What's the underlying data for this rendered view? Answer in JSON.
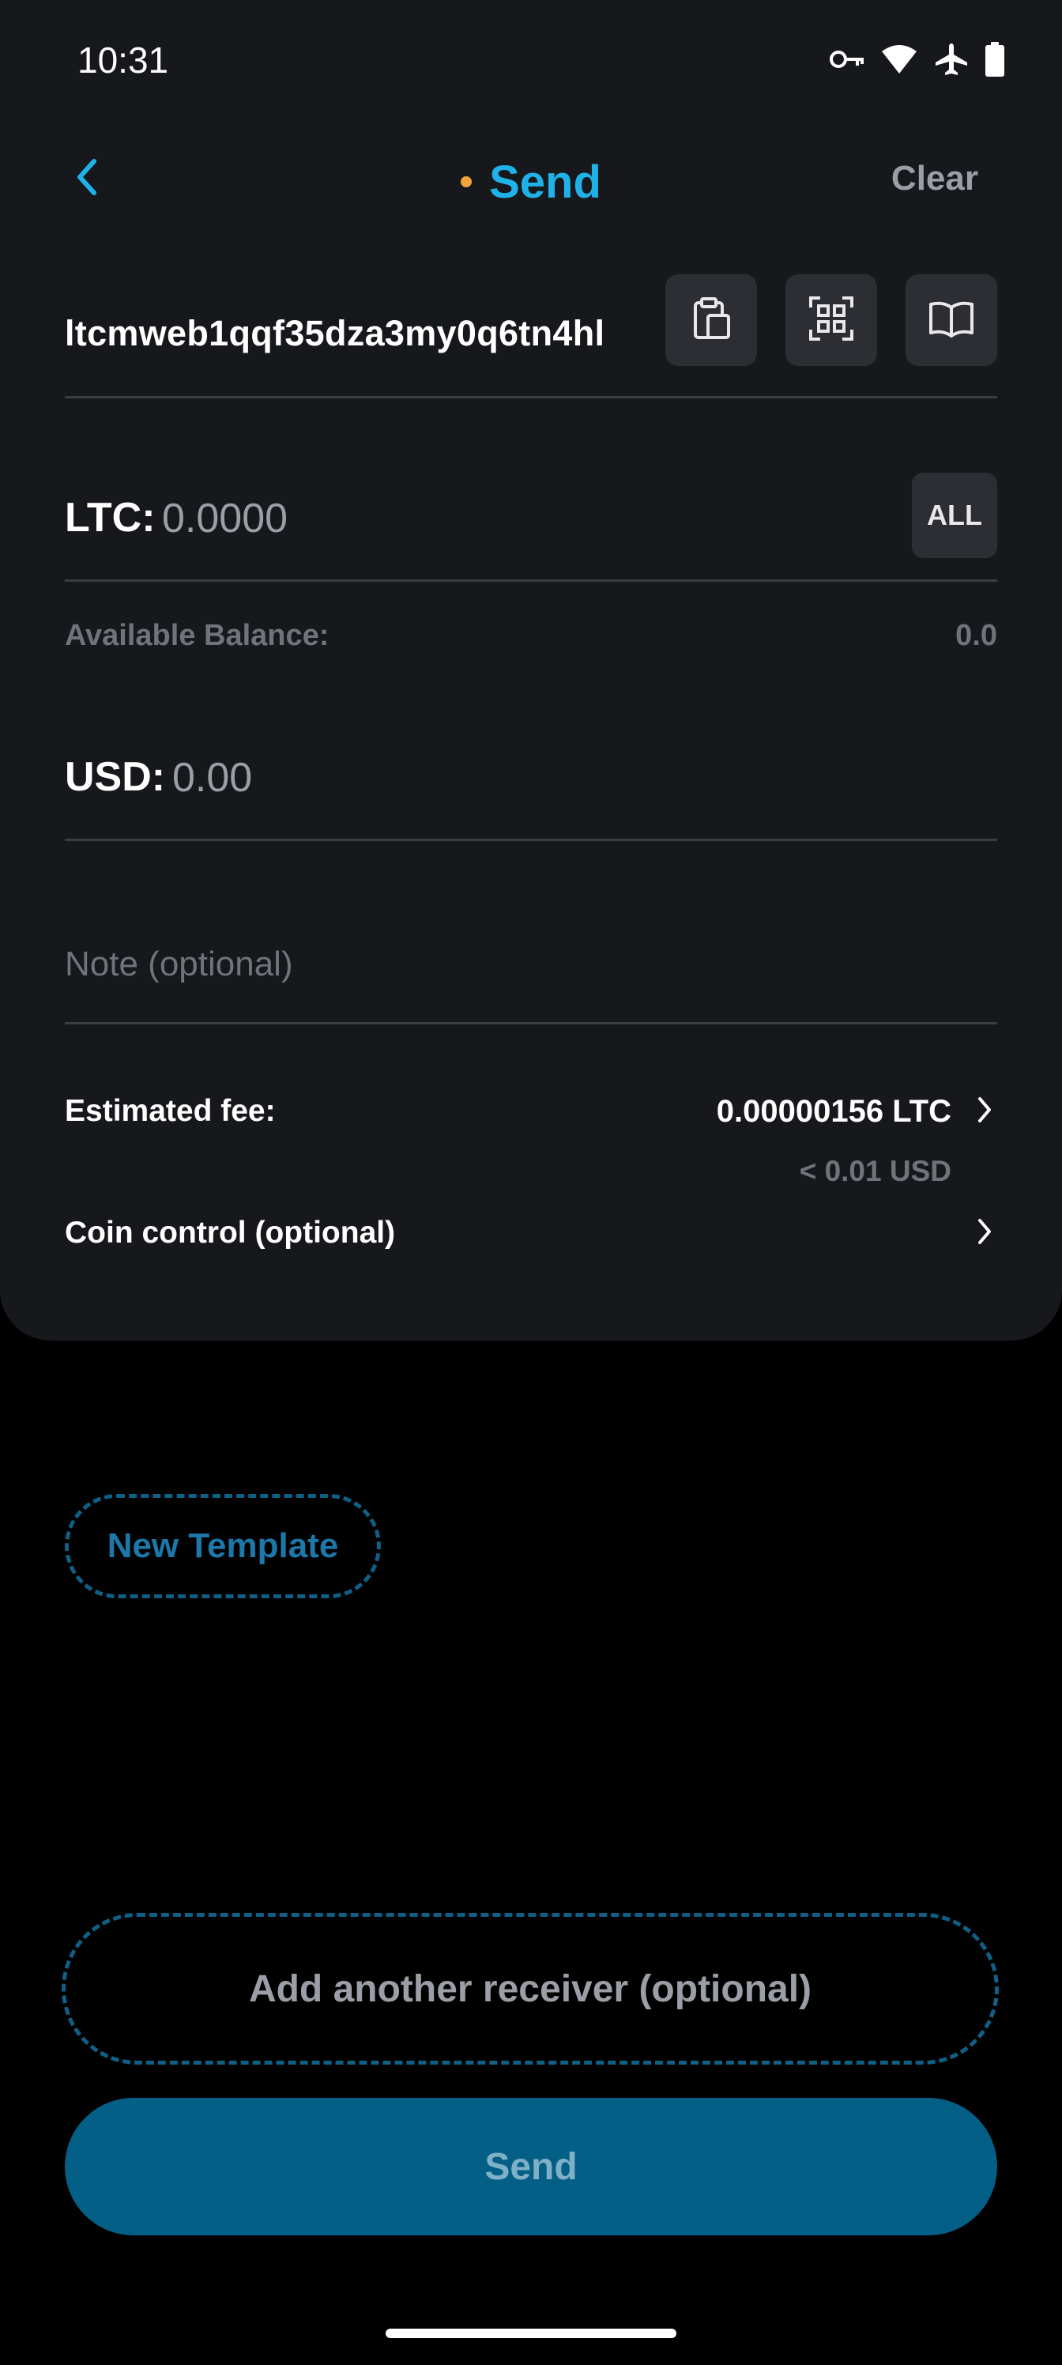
{
  "status_bar": {
    "time": "10:31",
    "icons": [
      "key-icon",
      "wifi-icon",
      "airplane-icon",
      "battery-icon"
    ]
  },
  "header": {
    "title": "Send",
    "clear_label": "Clear",
    "back_icon": "chevron-left-icon",
    "dot_color": "#f0a43a",
    "title_color": "#1fb2e8"
  },
  "address": {
    "value": "ltcmweb1qqf35dza3my0q6tn4hl",
    "buttons": [
      "paste-icon",
      "qr-scan-icon",
      "address-book-icon"
    ]
  },
  "ltc": {
    "label": "LTC:",
    "value": "0.0000",
    "all_label": "ALL"
  },
  "balance": {
    "label": "Available Balance:",
    "value": "0.0"
  },
  "usd": {
    "label": "USD:",
    "value": "0.00"
  },
  "note": {
    "placeholder": "Note (optional)"
  },
  "fee": {
    "label": "Estimated fee:",
    "value": "0.00000156 LTC",
    "usd": "< 0.01 USD"
  },
  "coin_control": {
    "label": "Coin control (optional)"
  },
  "template": {
    "label": "New Template"
  },
  "add_receiver": {
    "label": "Add another receiver (optional)"
  },
  "send": {
    "label": "Send",
    "color": "#035f86"
  }
}
